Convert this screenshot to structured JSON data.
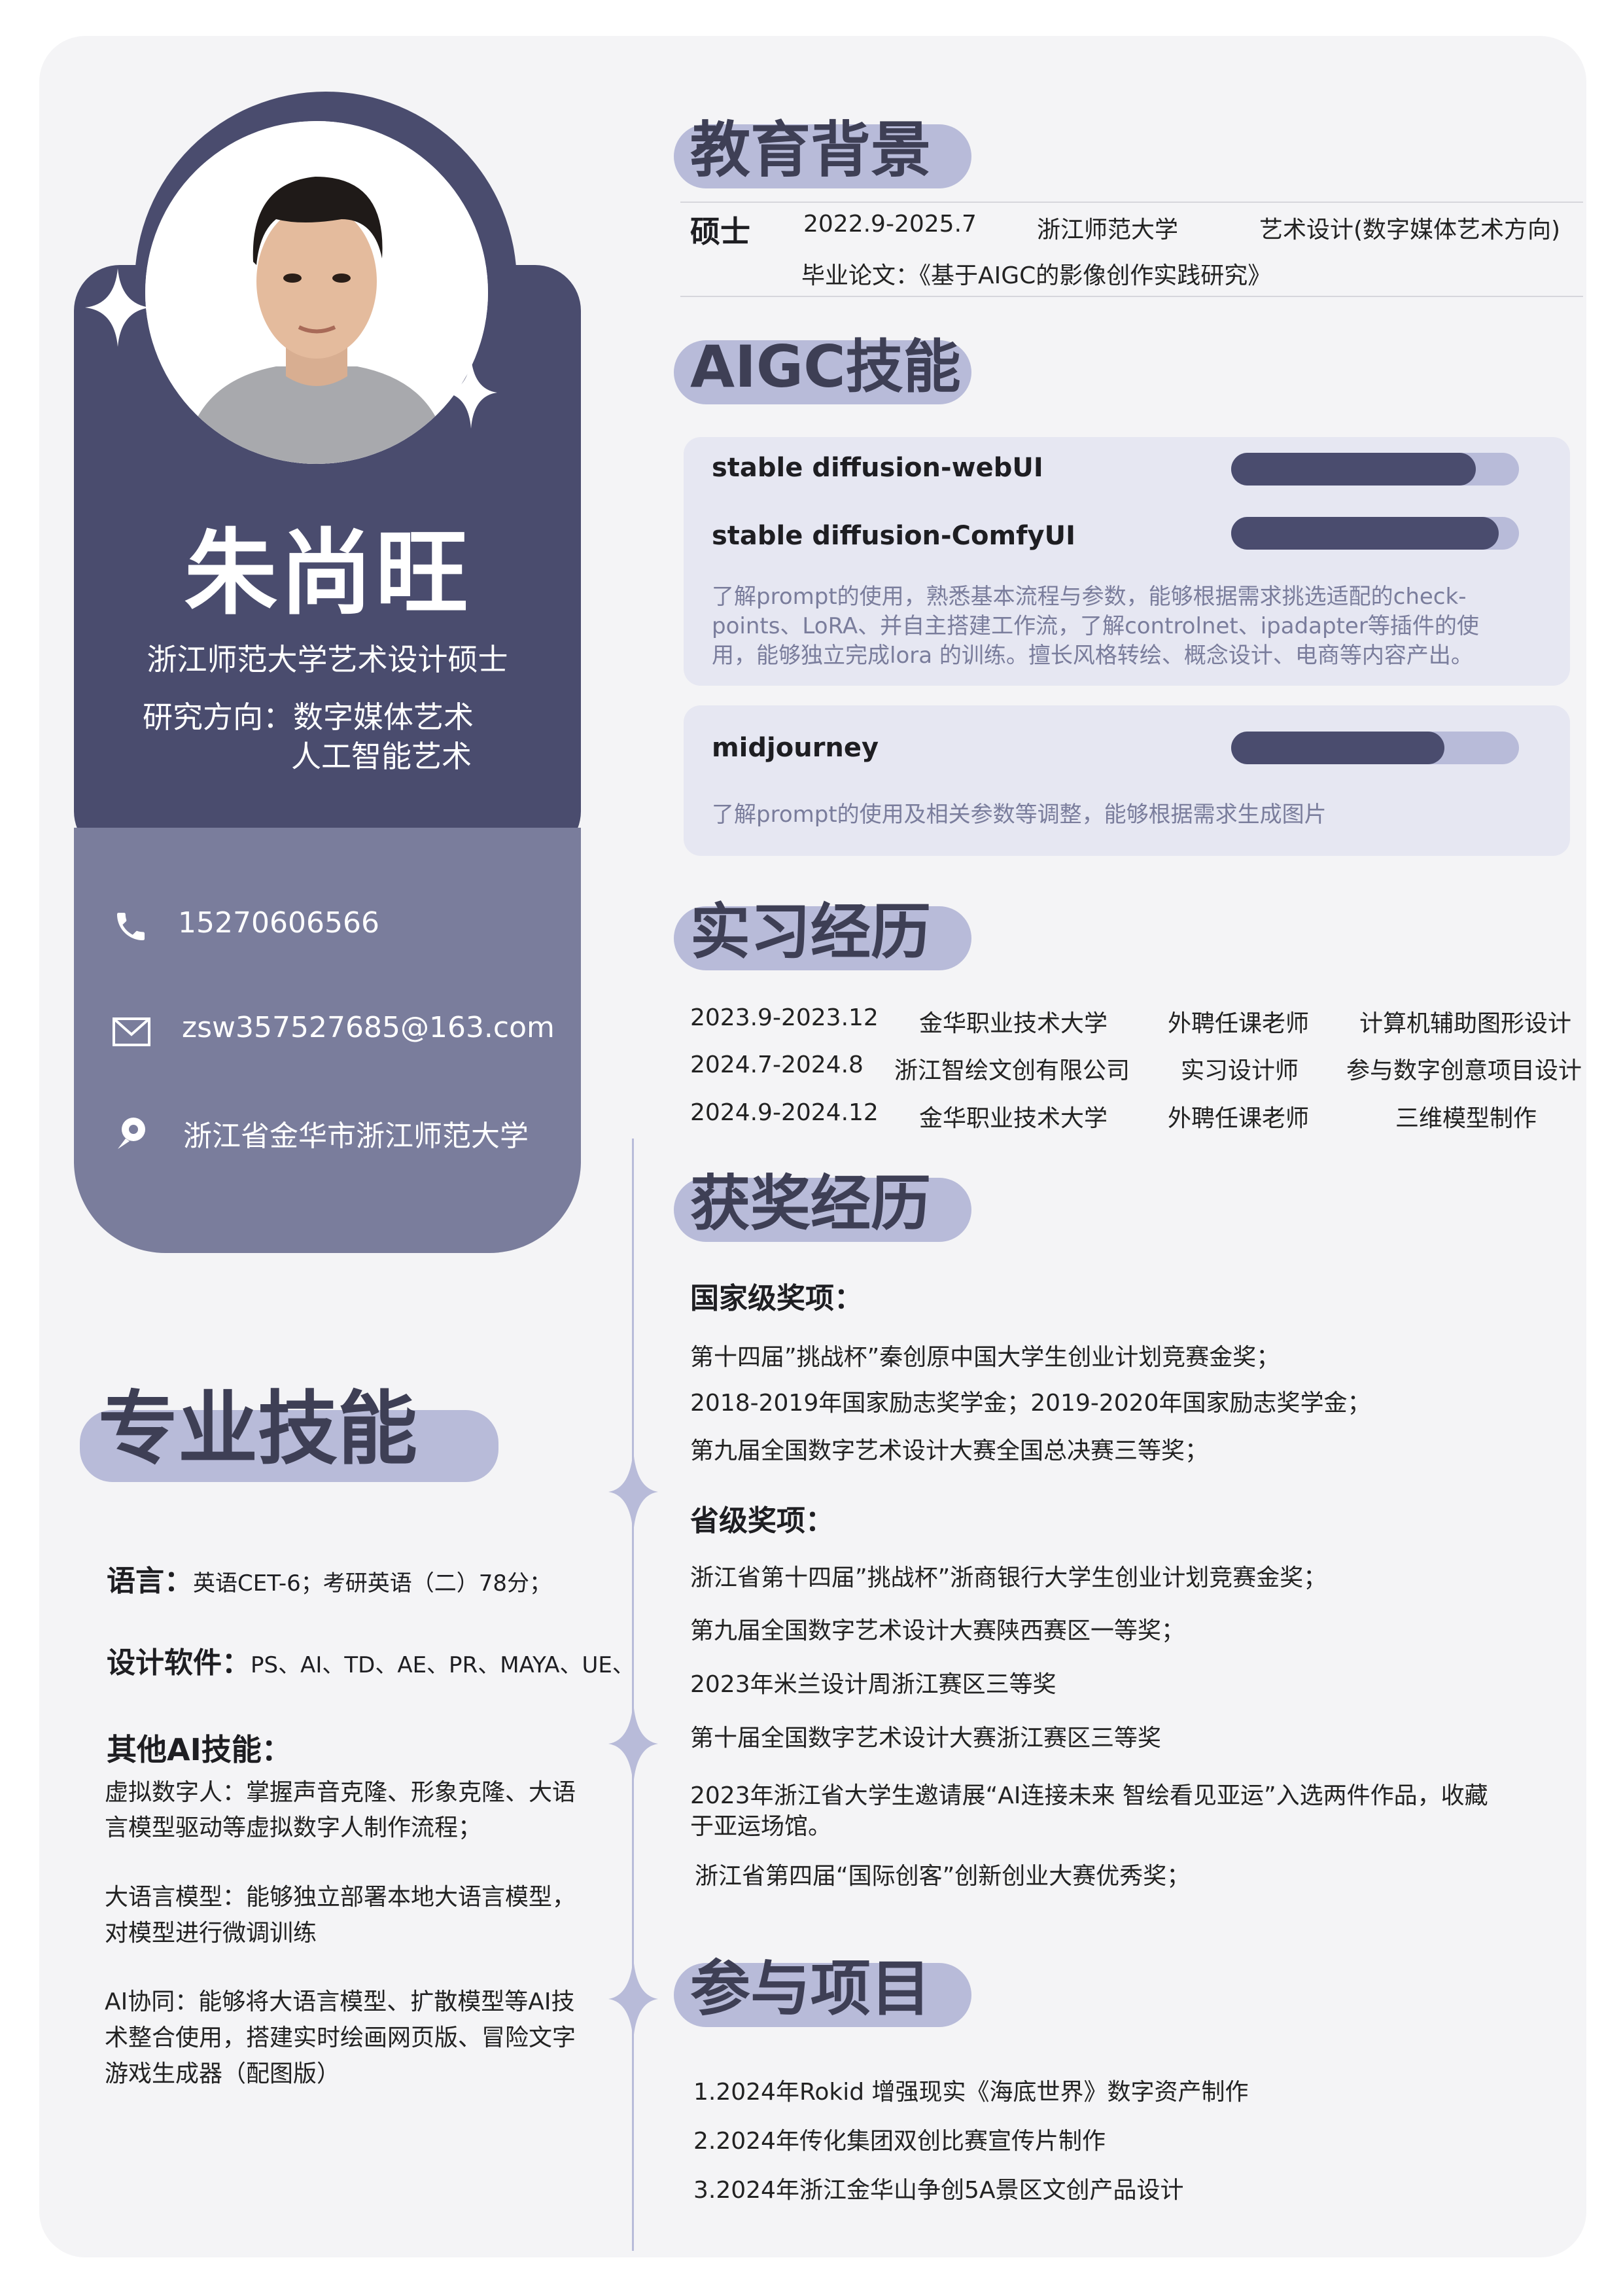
{
  "profile": {
    "name": "朱尚旺",
    "subtitle": "浙江师范大学艺术设计硕士",
    "research_line1": "研究方向：数字媒体艺术",
    "research_line2": "人工智能艺术"
  },
  "contacts": {
    "phone": "15270606566",
    "email": "zsw357527685@163.com",
    "address": "浙江省金华市浙江师范大学"
  },
  "sections": {
    "education": "教育背景",
    "aigc": "AIGC技能",
    "internship": "实习经历",
    "awards": "获奖经历",
    "skills": "专业技能",
    "projects": "参与项目"
  },
  "education": {
    "degree": "硕士",
    "period": "2022.9-2025.7",
    "school": "浙江师范大学",
    "major": "艺术设计(数字媒体艺术方向)",
    "thesis": "毕业论文：《基于AIGC的影像创作实践研究》"
  },
  "aigc": {
    "items": [
      {
        "label": "stable diffusion-webUI",
        "level": 0.85
      },
      {
        "label": "stable diffusion-ComfyUI",
        "level": 0.93
      },
      {
        "label": "midjourney",
        "level": 0.74
      }
    ],
    "sd_desc": [
      "了解prompt的使用，熟悉基本流程与参数，能够根据需求挑选适配的check-",
      "points、LoRA、并自主搭建工作流，了解controlnet、ipadapter等插件的使",
      "用，能够独立完成lora 的训练。擅长风格转绘、概念设计、电商等内容产出。"
    ],
    "mj_desc": "了解prompt的使用及相关参数等调整，能够根据需求生成图片"
  },
  "internships": [
    {
      "period": "2023.9-2023.12",
      "org": "金华职业技术大学",
      "role": "外聘任课老师",
      "work": "计算机辅助图形设计"
    },
    {
      "period": "2024.7-2024.8",
      "org": "浙江智绘文创有限公司",
      "role": "实习设计师",
      "work": "参与数字创意项目设计"
    },
    {
      "period": "2024.9-2024.12",
      "org": "金华职业技术大学",
      "role": "外聘任课老师",
      "work": "三维模型制作"
    }
  ],
  "awards": {
    "national_title": "国家级奖项：",
    "national": [
      "第十四届”挑战杯”秦创原中国大学生创业计划竞赛金奖；",
      "2018-2019年国家励志奖学金；2019-2020年国家励志奖学金；",
      "第九届全国数字艺术设计大赛全国总决赛三等奖；"
    ],
    "provincial_title": "省级奖项：",
    "provincial": [
      "浙江省第十四届”挑战杯”浙商银行大学生创业计划竞赛金奖；",
      "第九届全国数字艺术设计大赛陕西赛区一等奖；",
      "2023年米兰设计周浙江赛区三等奖",
      "第十届全国数字艺术设计大赛浙江赛区三等奖",
      "2023年浙江省大学生邀请展“AI连接未来 智绘看见亚运”入选两件作品，收藏",
      "于亚运场馆。",
      "浙江省第四届“国际创客”创新创业大赛优秀奖；"
    ]
  },
  "skills": {
    "language_label": "语言：",
    "language_value": "英语CET-6；考研英语（二）78分；",
    "software_label": "设计软件：",
    "software_value": "PS、AI、TD、AE、PR、MAYA、UE、",
    "ai_label": "其他AI技能：",
    "ai_lines": [
      "虚拟数字人：掌握声音克隆、形象克隆、大语",
      "言模型驱动等虚拟数字人制作流程；",
      "大语言模型：能够独立部署本地大语言模型，",
      "对模型进行微调训练",
      "AI协同：能够将大语言模型、扩散模型等AI技",
      "术整合使用，搭建实时绘画网页版、冒险文字",
      "游戏生成器（配图版）"
    ]
  },
  "projects": [
    "1.2024年Rokid 增强现实《海底世界》数字资产制作",
    "2.2024年传化集团双创比赛宣传片制作",
    "3.2024年浙江金华山争创5A景区文创产品设计"
  ],
  "colors": {
    "dark": "#4a4c6e",
    "mid": "#7a7d9c",
    "light": "#b8bbd9",
    "panel": "#e6e7f2"
  }
}
